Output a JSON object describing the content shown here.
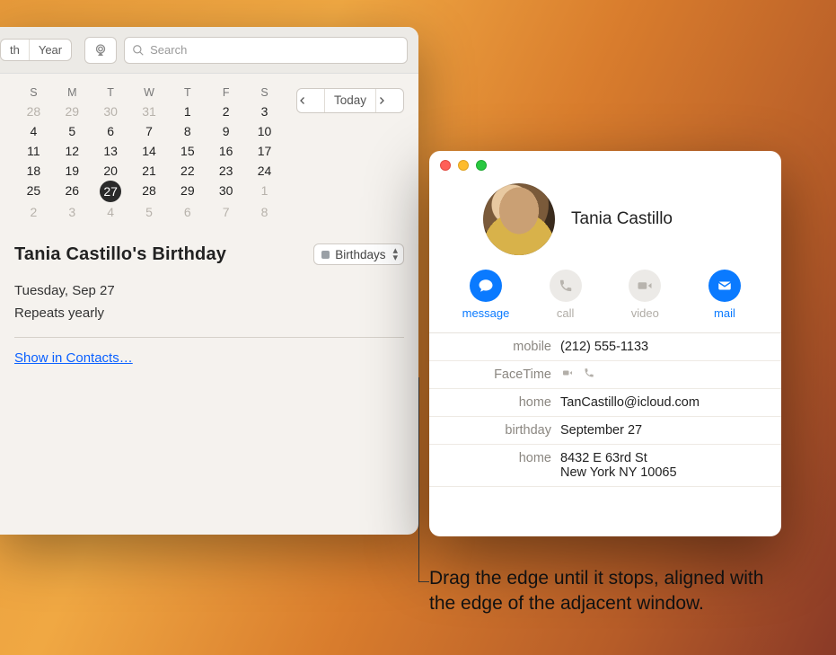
{
  "calendar": {
    "toolbar": {
      "seg_left": "th",
      "seg_right": "Year",
      "search_placeholder": "Search"
    },
    "mini": {
      "dows": [
        "S",
        "M",
        "T",
        "W",
        "T",
        "F",
        "S"
      ],
      "weeks": [
        {
          "days": [
            "28",
            "29",
            "30",
            "31",
            "1",
            "2",
            "3"
          ],
          "dim": [
            0,
            1,
            2,
            3
          ]
        },
        {
          "days": [
            "4",
            "5",
            "6",
            "7",
            "8",
            "9",
            "10"
          ],
          "dim": []
        },
        {
          "days": [
            "11",
            "12",
            "13",
            "14",
            "15",
            "16",
            "17"
          ],
          "dim": []
        },
        {
          "days": [
            "18",
            "19",
            "20",
            "21",
            "22",
            "23",
            "24"
          ],
          "dim": []
        },
        {
          "days": [
            "25",
            "26",
            "27",
            "28",
            "29",
            "30",
            "1"
          ],
          "dim": [
            6
          ],
          "today_idx": 2
        },
        {
          "days": [
            "2",
            "3",
            "4",
            "5",
            "6",
            "7",
            "8"
          ],
          "dim": [
            0,
            1,
            2,
            3,
            4,
            5,
            6
          ]
        }
      ],
      "today_label": "Today"
    },
    "event": {
      "title": "Tania Castillo's Birthday",
      "calendar_name": "Birthdays",
      "date": "Tuesday, Sep 27",
      "repeat": "Repeats yearly",
      "link": "Show in Contacts…"
    }
  },
  "contact": {
    "name": "Tania Castillo",
    "actions": {
      "message": "message",
      "call": "call",
      "video": "video",
      "mail": "mail"
    },
    "fields": {
      "mobile_label": "mobile",
      "mobile_value": "(212) 555-1133",
      "facetime_label": "FaceTime",
      "home_email_label": "home",
      "home_email_value": "TanCastillo@icloud.com",
      "birthday_label": "birthday",
      "birthday_value": "September 27",
      "home_addr_label": "home",
      "home_addr_line1": "8432 E 63rd St",
      "home_addr_line2": "New York NY 10065"
    }
  },
  "annotation": {
    "text": "Drag the edge until it stops, aligned with the edge of the adjacent window."
  }
}
